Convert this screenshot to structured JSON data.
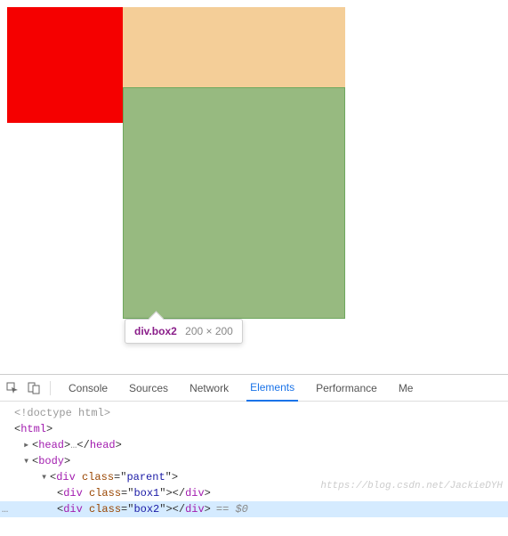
{
  "tooltip": {
    "selector": "div.box2",
    "dimensions": "200 × 200"
  },
  "devtools": {
    "tabs": [
      "Console",
      "Sources",
      "Network",
      "Elements",
      "Performance",
      "Me"
    ],
    "active_tab": "Elements",
    "dom": {
      "doctype": "<!doctype html>",
      "html_open": "html",
      "head_open": "head",
      "head_ellipsis": "…",
      "head_close": "head",
      "body_open": "body",
      "parent_open_tag": "div",
      "parent_class_attr": "class",
      "parent_class_val": "parent",
      "box1_tag": "div",
      "box1_class_attr": "class",
      "box1_class_val": "box1",
      "box2_tag": "div",
      "box2_class_attr": "class",
      "box2_class_val": "box2",
      "selection_suffix": "== $0",
      "gutter_dots": "…"
    }
  },
  "watermark": "https://blog.csdn.net/JackieDYH"
}
